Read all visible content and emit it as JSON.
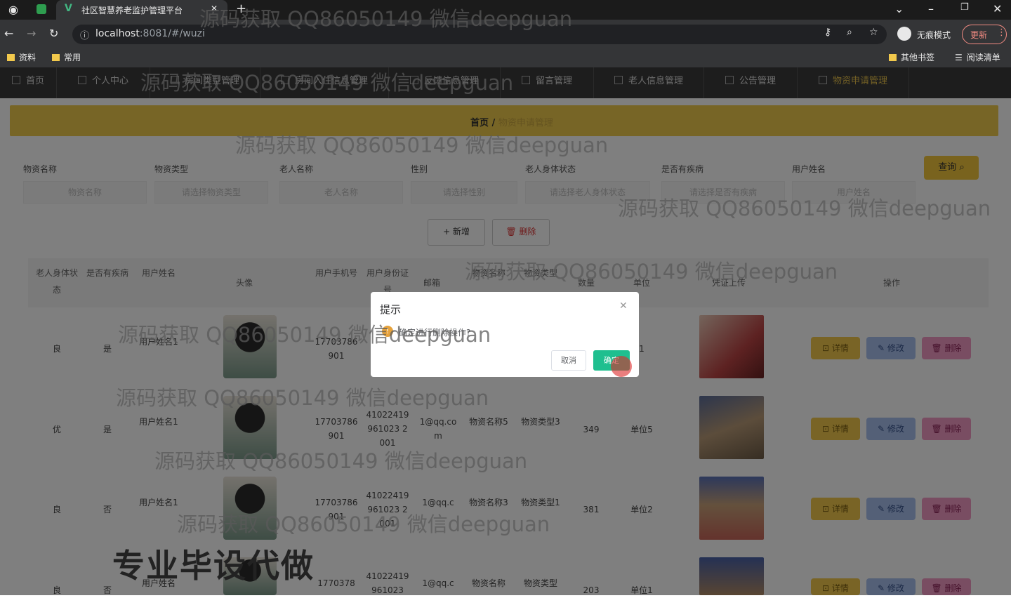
{
  "browser": {
    "tab_title": "社区智慧养老监护管理平台",
    "url_host": "localhost",
    "url_rest": ":8081/#/wuzi",
    "incognito_label": "无痕模式",
    "update_label": "更新",
    "bookmarks": [
      "资料",
      "常用"
    ],
    "other_bookmarks": "其他书签",
    "reading_list": "阅读清单"
  },
  "nav": {
    "items": [
      "首页",
      "个人中心",
      "房间类型管理",
      "房间入住信息管理",
      "反馈信息管理",
      "留言管理",
      "老人信息管理",
      "公告管理",
      "物资申请管理"
    ]
  },
  "breadcrumb": {
    "home": "首页",
    "separator": "/",
    "current": "物资申请管理"
  },
  "filters": {
    "labels": [
      "物资名称",
      "物资类型",
      "老人名称",
      "性别",
      "老人身体状态",
      "是否有疾病",
      "用户姓名"
    ],
    "placeholders": [
      "物资名称",
      "请选择物资类型",
      "老人名称",
      "请选择性别",
      "请选择老人身体状态",
      "请选择是否有疾病",
      "用户姓名"
    ],
    "query_label": "查询"
  },
  "actions": {
    "add_label": "+ 新增",
    "delete_label": "删除"
  },
  "table": {
    "headers": [
      "老人身体状态",
      "是否有疾病",
      "用户姓名",
      "头像",
      "用户手机号",
      "用户身份证号",
      "邮箱",
      "物资名称",
      "物资类型",
      "数量",
      "单位",
      "凭证上传",
      "操作"
    ],
    "rows": [
      {
        "status": "良",
        "disease": "是",
        "name": "用户姓名1",
        "phone": "17703786901",
        "idcard": "",
        "email": "",
        "item": "",
        "type": "",
        "qty": "",
        "unit": "1"
      },
      {
        "status": "优",
        "disease": "是",
        "name": "用户姓名1",
        "phone": "17703786901",
        "idcard": "41022419961023 2001",
        "email": "1@qq.com",
        "item": "物资名称5",
        "type": "物资类型3",
        "qty": "349",
        "unit": "单位5"
      },
      {
        "status": "良",
        "disease": "否",
        "name": "用户姓名1",
        "phone": "17703786901",
        "idcard": "41022419961023 2001",
        "email": "1@qq.c",
        "item": "物资名称3",
        "type": "物资类型1",
        "qty": "381",
        "unit": "单位2"
      },
      {
        "status": "良",
        "disease": "否",
        "name": "用户姓名",
        "phone": "1770378",
        "idcard": "41022419961023",
        "email": "1@qq.c",
        "item": "物资名称",
        "type": "物资类型",
        "qty": "203",
        "unit": "单位1"
      }
    ],
    "op_detail": "详情",
    "op_edit": "修改",
    "op_delete": "删除"
  },
  "dialog": {
    "title": "提示",
    "message": "确定进行删除操作?",
    "cancel": "取消",
    "confirm": "确定"
  },
  "watermark": {
    "text": "源码获取 QQ86050149 微信deepguan",
    "promo": "专业毕设代做"
  }
}
